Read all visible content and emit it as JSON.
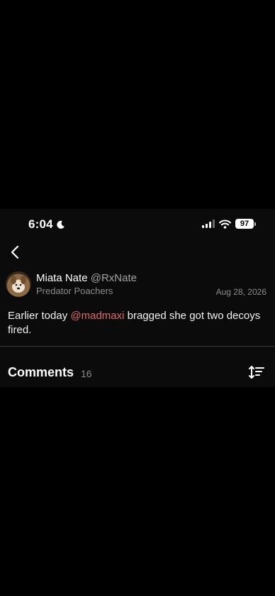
{
  "status_bar": {
    "time": "6:04",
    "battery": "97",
    "icons": [
      "moon-icon",
      "cellular-signal-icon",
      "wifi-icon",
      "battery-icon"
    ]
  },
  "nav": {
    "back_icon": "chevron-left-icon"
  },
  "post": {
    "author_name": "Miata Nate",
    "author_handle": "@RxNate",
    "group": "Predator Poachers",
    "date": "Aug 28, 2026",
    "body_before": "Earlier today ",
    "mention": "@madmaxi",
    "body_after": " bragged she got two decoys fired."
  },
  "comments": {
    "title": "Comments",
    "count": "16",
    "sort_icon": "sort-icon"
  },
  "colors": {
    "background": "#000000",
    "surface": "#0b0b0b",
    "mention": "#e06b6b",
    "secondary_text": "#8c8c8c"
  }
}
